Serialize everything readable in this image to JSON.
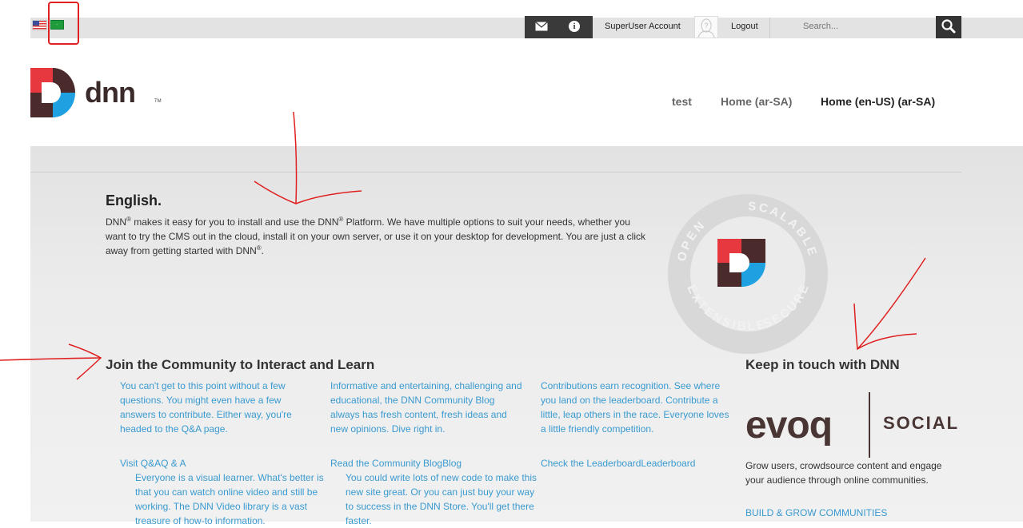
{
  "topbar": {
    "superuser": "SuperUser Account",
    "logout": "Logout",
    "search_placeholder": "Search..."
  },
  "logo": {
    "text": "dnn",
    "tm": "TM"
  },
  "nav": [
    "test",
    "Home (ar-SA)",
    "Home (en-US) (ar-SA)"
  ],
  "english": {
    "title": "English.",
    "p1": "DNN",
    "p2": " makes it easy for you to install and use the DNN",
    "p3": " Platform. We have multiple options to suit your needs, whether you want to try the CMS out in the cloud, install it on your own server, or use it on your desktop for development. You are just a click away from getting started with DNN",
    "p4": ".",
    "reg": "®"
  },
  "badge": {
    "words": [
      "OPEN",
      "SCALABLE",
      "EXTENSIBLE",
      "SECURE"
    ]
  },
  "community": {
    "title": "Join the Community to Interact and Learn",
    "col1": "You can't get to this point without a few questions. You might even have a few answers to contribute. Either way, you're headed to the Q&A page.",
    "col2": "Informative and entertaining, challenging and educational, the DNN Community Blog always has fresh content, fresh ideas and new opinions. Dive right in.",
    "col3": "Contributions earn recognition. See where you land on the leaderboard. Contribute a little, leap others in the race. Everyone loves a little friendly competition.",
    "link1": "Visit Q&AQ & A",
    "link2": "Read the Community BlogBlog",
    "link3": "Check the LeaderboardLeaderboard",
    "sub1": "Everyone is a visual learner. What's better is that you can watch online video and still be working. The DNN Video library is a vast treasure of how-to information.",
    "sub2": "You could write lots of new code to make this new site great. Or you can just buy your way to success in the DNN Store. You'll get there faster."
  },
  "keep": {
    "title": "Keep in touch with DNN",
    "evoq": "evoq",
    "social": "SOCIAL",
    "p": "Grow users, crowdsource content and engage your audience through online communities.",
    "link": "BUILD & GROW COMMUNITIES"
  },
  "colors": {
    "accent_red": "#e8383f",
    "accent_blue": "#1fa0e0",
    "accent_dark": "#4a2a2a",
    "link": "#3a9ad0",
    "annotation": "#e02020"
  }
}
